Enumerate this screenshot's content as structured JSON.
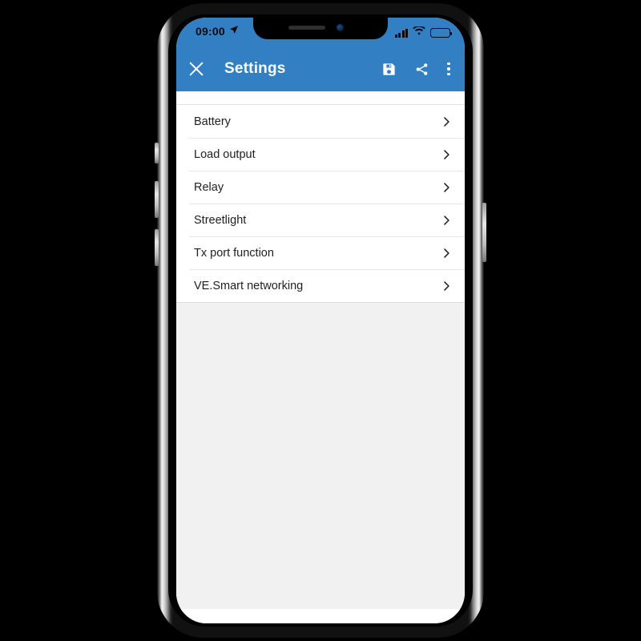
{
  "device": {
    "type": "smartphone",
    "frame_color": "#111111",
    "screen_bg": "#f1f1f1"
  },
  "status_bar": {
    "time": "09:00",
    "location_icon": "location-arrow-icon",
    "signal_icon": "cellular-signal-icon",
    "signal_bars": 4,
    "wifi_icon": "wifi-icon",
    "battery_icon": "battery-full-icon",
    "background_color": "#3280c3",
    "foreground_color": "#0a0a0a"
  },
  "app_bar": {
    "close_icon": "close-icon",
    "title": "Settings",
    "background_color": "#3280c3",
    "text_color": "#ffffff",
    "actions": [
      {
        "name": "save-icon",
        "label": "Save"
      },
      {
        "name": "share-icon",
        "label": "Share"
      },
      {
        "name": "overflow-menu-icon",
        "label": "More options"
      }
    ]
  },
  "settings_list": {
    "items": [
      {
        "label": "Battery",
        "chevron": "chevron-right-icon"
      },
      {
        "label": "Load output",
        "chevron": "chevron-right-icon"
      },
      {
        "label": "Relay",
        "chevron": "chevron-right-icon"
      },
      {
        "label": "Streetlight",
        "chevron": "chevron-right-icon"
      },
      {
        "label": "Tx port function",
        "chevron": "chevron-right-icon"
      },
      {
        "label": "VE.Smart networking",
        "chevron": "chevron-right-icon"
      }
    ]
  },
  "home_indicator": {
    "name": "home-indicator"
  }
}
